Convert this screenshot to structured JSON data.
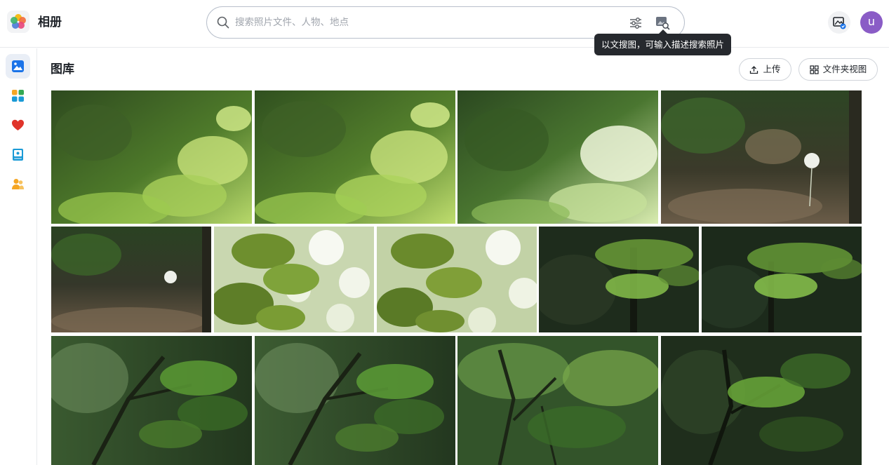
{
  "app": {
    "title": "相册"
  },
  "search": {
    "placeholder": "搜索照片文件、人物、地点",
    "value": "",
    "tooltip": "以文搜图，可输入描述搜索照片"
  },
  "user": {
    "avatar_letter": "u",
    "avatar_color": "#8a5cc6"
  },
  "sidebar": {
    "items": [
      {
        "name": "gallery",
        "icon": "image-icon",
        "active": true
      },
      {
        "name": "albums",
        "icon": "grid-icon",
        "active": false
      },
      {
        "name": "favorites",
        "icon": "heart-icon",
        "active": false
      },
      {
        "name": "memories",
        "icon": "book-icon",
        "active": false
      },
      {
        "name": "people",
        "icon": "people-icon",
        "active": false
      }
    ]
  },
  "main": {
    "title": "图库",
    "upload_label": "上传",
    "folder_view_label": "文件夹视图"
  },
  "colors": {
    "accent": "#1a73e8",
    "tooltip_bg": "#26292e",
    "border": "#e8eaed"
  },
  "photos": [
    {
      "row": 1,
      "subject": "sunlit green leaves"
    },
    {
      "row": 1,
      "subject": "sunlit green leaves"
    },
    {
      "row": 1,
      "subject": "bright leaves in forest"
    },
    {
      "row": 1,
      "subject": "white flower on dark forest floor"
    },
    {
      "row": 2,
      "subject": "white flower on forest floor"
    },
    {
      "row": 2,
      "subject": "leaves with bokeh"
    },
    {
      "row": 2,
      "subject": "leaves with bokeh"
    },
    {
      "row": 2,
      "subject": "branch in dark forest"
    },
    {
      "row": 2,
      "subject": "branch in dark forest"
    },
    {
      "row": 3,
      "subject": "tree branches with leaves"
    },
    {
      "row": 3,
      "subject": "tree branches with leaves"
    },
    {
      "row": 3,
      "subject": "forest canopy"
    },
    {
      "row": 3,
      "subject": "dark forest with leaves"
    }
  ]
}
